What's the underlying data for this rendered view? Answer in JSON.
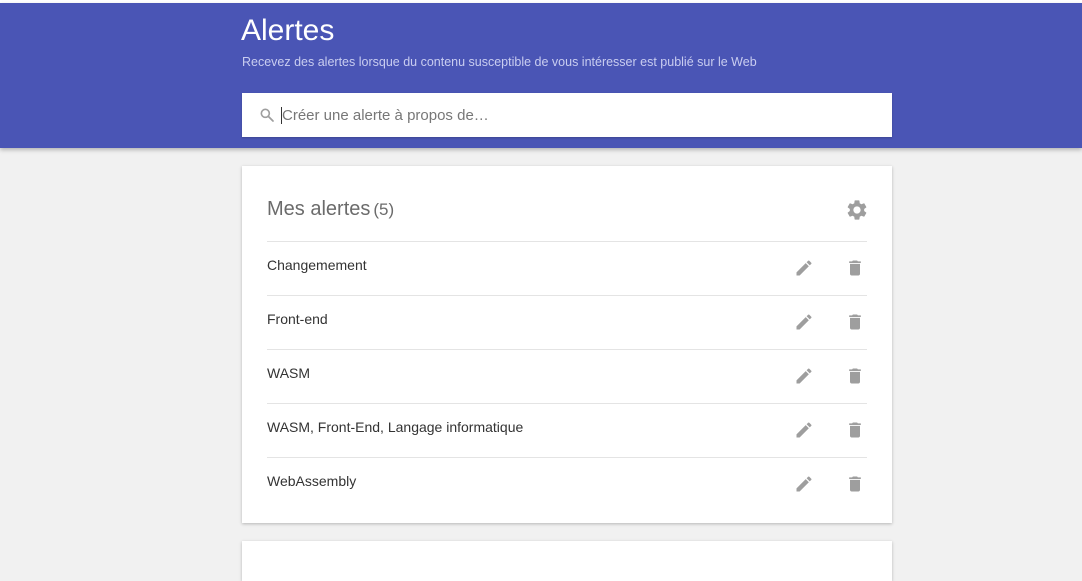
{
  "header": {
    "title": "Alertes",
    "subtitle": "Recevez des alertes lorsque du contenu susceptible de vous intéresser est publié sur le Web"
  },
  "search": {
    "placeholder": "Créer une alerte à propos de…",
    "icon": "search-icon"
  },
  "alerts_card": {
    "title": "Mes alertes",
    "count": "(5)",
    "settings_icon": "gear-icon",
    "items": [
      {
        "label": "Changemement"
      },
      {
        "label": "Front-end"
      },
      {
        "label": "WASM"
      },
      {
        "label": "WASM, Front-End, Langage informatique"
      },
      {
        "label": "WebAssembly"
      }
    ]
  },
  "colors": {
    "header_bg": "#4a55b5",
    "page_bg": "#f1f1f1",
    "icon_gray": "#9e9e9e"
  }
}
